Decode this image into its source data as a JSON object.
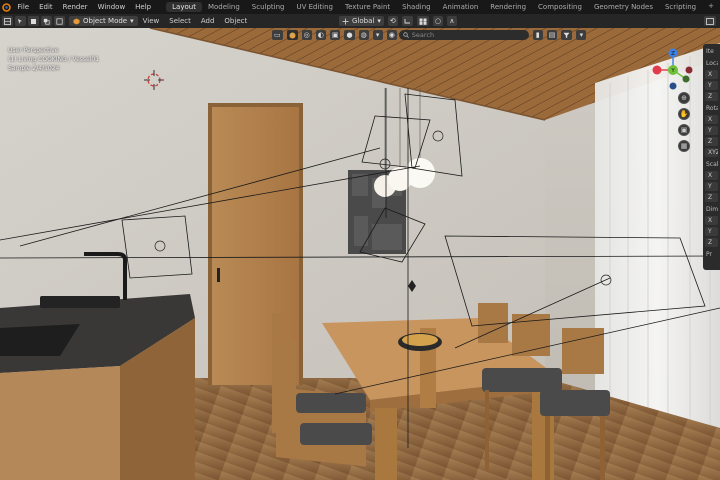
{
  "menubar": {
    "items": [
      "File",
      "Edit",
      "Render",
      "Window",
      "Help"
    ],
    "workspaces": [
      "Layout",
      "Modeling",
      "Sculpting",
      "UV Editing",
      "Texture Paint",
      "Shading",
      "Animation",
      "Rendering",
      "Compositing",
      "Geometry Nodes",
      "Scripting"
    ],
    "active_workspace": "Layout",
    "add_tab": "+"
  },
  "header": {
    "mode": "Object Mode",
    "menus": [
      "View",
      "Select",
      "Add",
      "Object"
    ],
    "transform_orientation": "Global"
  },
  "viewport_tools": {
    "search_placeholder": "Search"
  },
  "overlay": {
    "line1": "User Perspective",
    "line2": "(1) Living COOKING / Vessel01",
    "line3": "Sample 2/4/1024"
  },
  "npanel": {
    "tab": "Ite",
    "rows": [
      "Ite",
      "Loca",
      "X",
      "Y",
      "Z",
      "Rotat",
      "X",
      "Y",
      "Z",
      "XYZ",
      "Scale",
      "X",
      "Y",
      "Z",
      "Dime",
      "X",
      "Y",
      "Z",
      "Pr"
    ]
  },
  "gizmo": {
    "axes": {
      "x": "X",
      "y": "Y",
      "z": "Z"
    },
    "colors": {
      "x": "#e03c4b",
      "y": "#6fc13a",
      "z": "#3b82e6"
    }
  }
}
